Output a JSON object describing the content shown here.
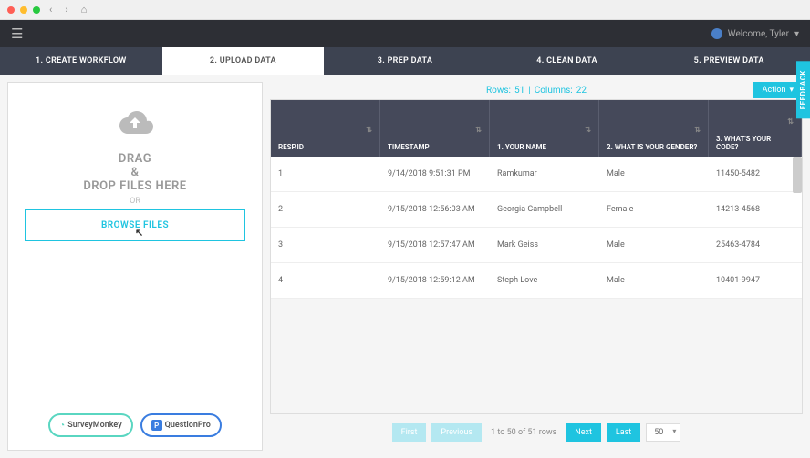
{
  "welcome": {
    "text": "Welcome, Tyler"
  },
  "tabs": [
    {
      "label": "1. CREATE WORKFLOW"
    },
    {
      "label": "2. UPLOAD DATA"
    },
    {
      "label": "3. PREP DATA"
    },
    {
      "label": "4. CLEAN DATA"
    },
    {
      "label": "5. PREVIEW DATA"
    }
  ],
  "upload": {
    "drag1": "DRAG",
    "drag2": "&",
    "drag3": "DROP FILES HERE",
    "or": "OR",
    "browse": "BROWSE FILES",
    "sm": "SurveyMonkey",
    "qp": "QuestionPro"
  },
  "summary": {
    "rows_label": "Rows:",
    "rows": "51",
    "sep": "|",
    "cols_label": "Columns:",
    "cols": "22",
    "action": "Action"
  },
  "table": {
    "headers": [
      "RESP.ID",
      "TIMESTAMP",
      "1. YOUR NAME",
      "2. WHAT IS YOUR GENDER?",
      "3. WHAT'S YOUR CODE?"
    ],
    "rows": [
      {
        "id": "1",
        "ts": "9/14/2018 9:51:31 PM",
        "name": "Ramkumar",
        "gender": "Male",
        "code": "11450-5482"
      },
      {
        "id": "2",
        "ts": "9/15/2018 12:56:03 AM",
        "name": "Georgia Campbell",
        "gender": "Female",
        "code": "14213-4568"
      },
      {
        "id": "3",
        "ts": "9/15/2018 12:57:47 AM",
        "name": "Mark Geiss",
        "gender": "Male",
        "code": "25463-4784"
      },
      {
        "id": "4",
        "ts": "9/15/2018 12:59:12 AM",
        "name": "Steph Love",
        "gender": "Male",
        "code": "10401-9947"
      }
    ]
  },
  "pager": {
    "first": "First",
    "prev": "Previous",
    "info": "1 to 50 of 51 rows",
    "next": "Next",
    "last": "Last",
    "size": "50"
  },
  "feedback": "FEEDBACK"
}
